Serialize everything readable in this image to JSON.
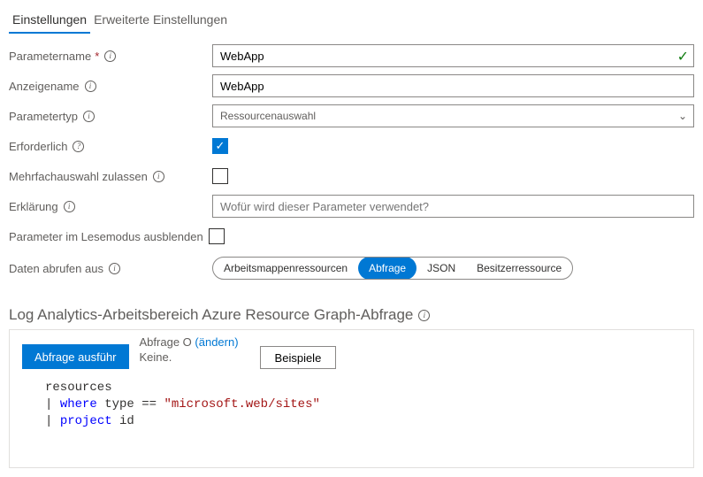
{
  "tabs": {
    "settings": "Einstellungen",
    "advanced": "Erweiterte Einstellungen"
  },
  "labels": {
    "paramName": "Parametername",
    "displayName": "Anzeigename",
    "paramType": "Parametertyp",
    "required": "Erforderlich",
    "multiSelect": "Mehrfachauswahl zulassen",
    "explanation": "Erklärung",
    "hideReadMode": "Parameter im Lesemodus ausblenden",
    "dataFrom": "Daten abrufen aus"
  },
  "fields": {
    "paramName": "WebApp",
    "displayName": "WebApp",
    "paramType": "Ressourcenauswahl",
    "explanationPlaceholder": "Wofür wird dieser Parameter verwendet?"
  },
  "pills": {
    "workbook": "Arbeitsmappenressourcen",
    "query": "Abfrage",
    "json": "JSON",
    "owner": "Besitzerressource"
  },
  "section": "Log Analytics-Arbeitsbereich Azure Resource Graph-Abfrage",
  "queryPanel": {
    "run": "Abfrage ausführ",
    "meta1a": "Abfrage O",
    "meta1b": "(ändern)",
    "meta2": "Keine.",
    "examples": "Beispiele"
  },
  "code": {
    "l1": "resources",
    "l2pipe": "| ",
    "l2kw": "where",
    "l2mid": " type == ",
    "l2str": "\"microsoft.web/sites\"",
    "l3pipe": "| ",
    "l3kw": "project",
    "l3id": " id"
  }
}
